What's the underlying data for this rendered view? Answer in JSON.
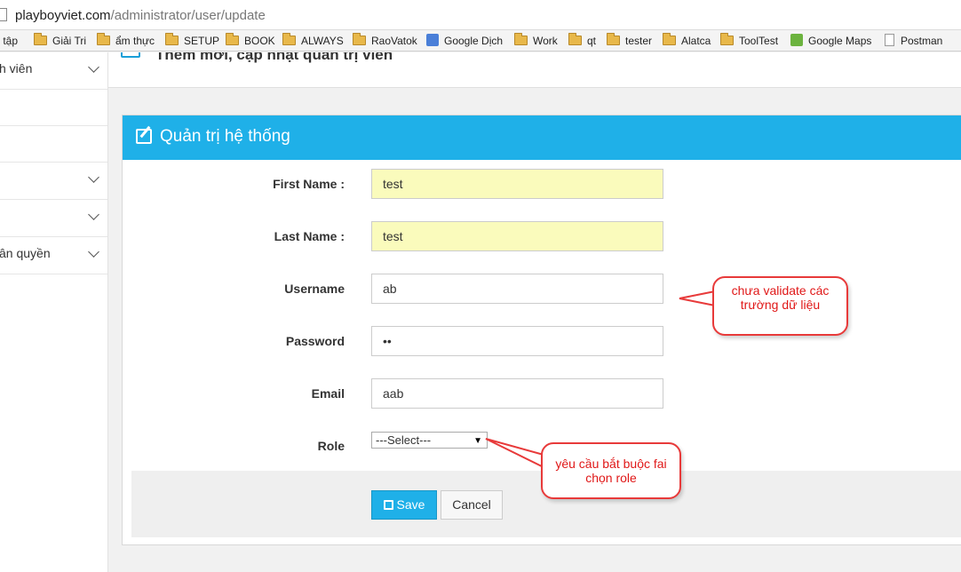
{
  "browser": {
    "url_host": "playboyviet.com",
    "url_path": "/administrator/user/update"
  },
  "bookmarks": [
    {
      "label": "c tập",
      "icon": "none"
    },
    {
      "label": "Giải Tri",
      "icon": "folder-icon"
    },
    {
      "label": "ẩm thực",
      "icon": "folder-icon"
    },
    {
      "label": "SETUP",
      "icon": "folder-icon"
    },
    {
      "label": "BOOK",
      "icon": "folder-icon"
    },
    {
      "label": "ALWAYS",
      "icon": "folder-icon"
    },
    {
      "label": "RaoVatok",
      "icon": "folder-icon"
    },
    {
      "label": "Google Dịch",
      "icon": "google-translate-icon"
    },
    {
      "label": "Work",
      "icon": "folder-icon"
    },
    {
      "label": "qt",
      "icon": "folder-icon"
    },
    {
      "label": "tester",
      "icon": "folder-icon"
    },
    {
      "label": "Alatca",
      "icon": "folder-icon"
    },
    {
      "label": "ToolTest",
      "icon": "folder-icon"
    },
    {
      "label": "Google Maps",
      "icon": "google-maps-icon"
    },
    {
      "label": "Postman",
      "icon": "document-icon"
    }
  ],
  "sidebar": {
    "items": [
      {
        "label": "h viên",
        "chevron": true
      },
      {
        "label": "",
        "chevron": false
      },
      {
        "label": "",
        "chevron": false
      },
      {
        "label": "",
        "chevron": true
      },
      {
        "label": "",
        "chevron": true
      },
      {
        "label": "ân quyền",
        "chevron": true
      }
    ]
  },
  "header": {
    "title": "Thêm mới, cập nhật quản trị viên"
  },
  "panel": {
    "title": "Quản trị hệ thống"
  },
  "form": {
    "first_name_label": "First Name :",
    "first_name_value": "test",
    "last_name_label": "Last Name :",
    "last_name_value": "test",
    "username_label": "Username",
    "username_value": "ab",
    "password_label": "Password",
    "password_value": "••",
    "email_label": "Email",
    "email_value": "aab",
    "role_label": "Role",
    "role_value": "---Select---",
    "save_label": "Save",
    "cancel_label": "Cancel"
  },
  "annotations": {
    "validate_note": "chưa validate các trường dữ liệu",
    "role_note": "yêu cầu bắt buộc fai chọn role"
  },
  "colors": {
    "accent": "#1fb0e8",
    "highlight_input": "#fafbbc",
    "annotation": "#e83a3a"
  }
}
